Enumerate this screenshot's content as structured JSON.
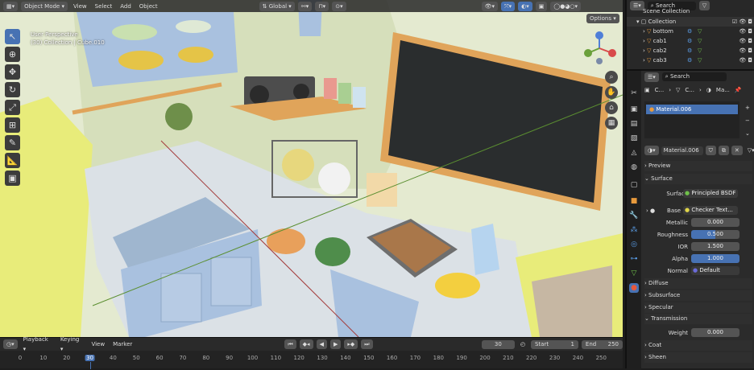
{
  "header": {
    "mode": "Object Mode",
    "menus": [
      "View",
      "Select",
      "Add",
      "Object"
    ],
    "transform_orientation": "Global",
    "options": "Options"
  },
  "viewport": {
    "perspective": "User Perspective",
    "context": "(30) Collection | Cube.010"
  },
  "timeline": {
    "menus": [
      "Playback",
      "Keying",
      "View",
      "Marker"
    ],
    "current_frame": "30",
    "start_label": "Start",
    "start": "1",
    "end_label": "End",
    "end": "250",
    "ruler": [
      "0",
      "10",
      "20",
      "30",
      "40",
      "50",
      "60",
      "70",
      "80",
      "90",
      "100",
      "110",
      "120",
      "130",
      "140",
      "150",
      "160",
      "170",
      "180",
      "190",
      "200",
      "210",
      "220",
      "230",
      "240",
      "250"
    ]
  },
  "outliner": {
    "search_placeholder": "Search",
    "scene_collection": "Scene Collection",
    "collection": "Collection",
    "items": [
      "bottom",
      "cab1",
      "cab2",
      "cab3"
    ]
  },
  "properties": {
    "search_placeholder": "Search",
    "breadcrumb": [
      "C...",
      "C...",
      "Ma..."
    ],
    "slot": "Material.006",
    "material_name": "Material.006",
    "sections": {
      "preview": "Preview",
      "surface": "Surface",
      "diffuse": "Diffuse",
      "subsurface": "Subsurface",
      "specular": "Specular",
      "transmission": "Transmission",
      "coat": "Coat",
      "sheen": "Sheen"
    },
    "surface_label": "Surface",
    "surface_value": "Principled BSDF",
    "base_label": "Base ...",
    "base_value": "Checker Text...",
    "metallic_label": "Metallic",
    "metallic": "0.000",
    "roughness_label": "Roughness",
    "roughness": "0.500",
    "ior_label": "IOR",
    "ior": "1.500",
    "alpha_label": "Alpha",
    "alpha": "1.000",
    "normal_label": "Normal",
    "normal": "Default",
    "weight_label": "Weight",
    "weight": "0.000"
  },
  "colors": {
    "accent": "#4772b3",
    "wall": "#dfe6c6",
    "cabinet": "#a9c1df",
    "chalkboard": "#2a2d2e",
    "frame": "#e0a45a"
  }
}
